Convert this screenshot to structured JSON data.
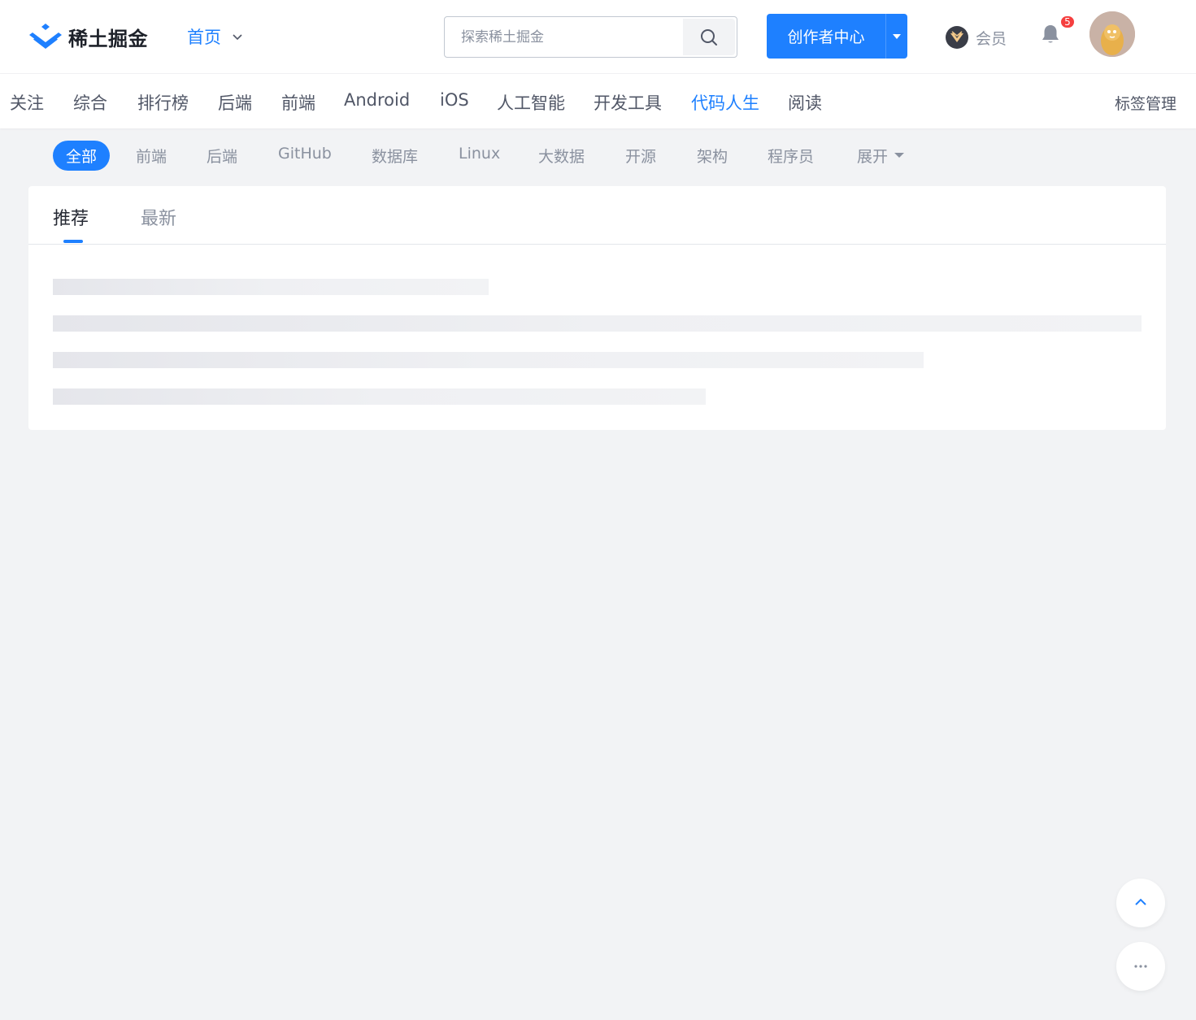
{
  "header": {
    "logo_text": "稀土掘金",
    "home_label": "首页",
    "search_placeholder": "探索稀土掘金",
    "creator_center": "创作者中心",
    "vip_label": "会员",
    "notification_count": "5"
  },
  "categories": {
    "items": [
      {
        "label": "关注"
      },
      {
        "label": "综合"
      },
      {
        "label": "排行榜"
      },
      {
        "label": "后端"
      },
      {
        "label": "前端"
      },
      {
        "label": "Android"
      },
      {
        "label": "iOS"
      },
      {
        "label": "人工智能"
      },
      {
        "label": "开发工具"
      },
      {
        "label": "代码人生"
      },
      {
        "label": "阅读"
      }
    ],
    "active_label": "代码人生",
    "tag_manage": "标签管理"
  },
  "subtags": {
    "items": [
      {
        "label": "全部"
      },
      {
        "label": "前端"
      },
      {
        "label": "后端"
      },
      {
        "label": "GitHub"
      },
      {
        "label": "数据库"
      },
      {
        "label": "Linux"
      },
      {
        "label": "大数据"
      },
      {
        "label": "开源"
      },
      {
        "label": "架构"
      },
      {
        "label": "程序员"
      }
    ],
    "active_label": "全部",
    "expand_label": "展开"
  },
  "feed": {
    "tabs": [
      {
        "label": "推荐"
      },
      {
        "label": "最新"
      }
    ],
    "active_tab": "推荐"
  },
  "colors": {
    "accent": "#1e80ff",
    "badge": "#f53f3f",
    "background": "#f2f3f5"
  },
  "icons": {
    "search": "search-icon",
    "bell": "bell-icon",
    "vip": "vip-badge-icon",
    "dropdown": "chevron-down-icon",
    "back_to_top": "arrow-up-icon",
    "more": "more-icon"
  }
}
